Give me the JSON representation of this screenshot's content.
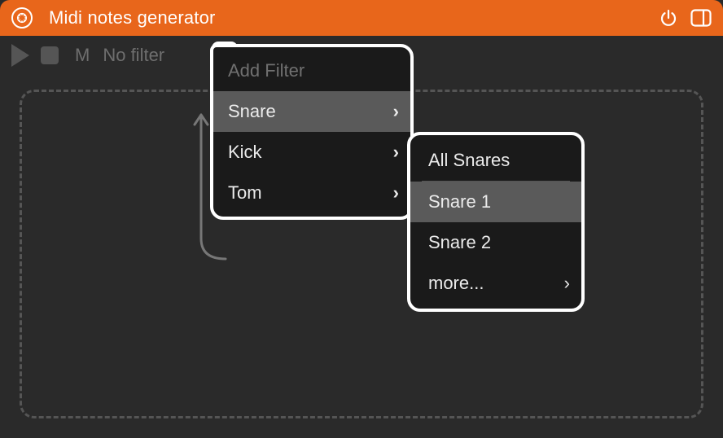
{
  "header": {
    "title": "Midi notes generator"
  },
  "toolbar": {
    "mute_label": "M",
    "filter_label": "No filter",
    "plus_label": "+"
  },
  "menu": {
    "header": "Add Filter",
    "items": [
      {
        "label": "Snare",
        "has_submenu": true,
        "highlight": true
      },
      {
        "label": "Kick",
        "has_submenu": true,
        "highlight": false
      },
      {
        "label": "Tom",
        "has_submenu": true,
        "highlight": false
      }
    ]
  },
  "submenu": {
    "items": [
      {
        "label": "All Snares",
        "has_submenu": false,
        "highlight": false
      },
      {
        "label": "Snare 1",
        "has_submenu": false,
        "highlight": true
      },
      {
        "label": "Snare 2",
        "has_submenu": false,
        "highlight": false
      },
      {
        "label": "more...",
        "has_submenu": true,
        "highlight": false
      }
    ]
  }
}
